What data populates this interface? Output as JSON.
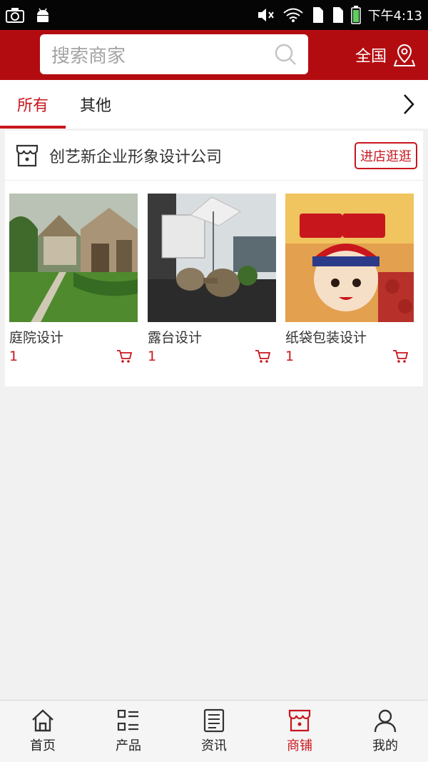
{
  "status_bar": {
    "time": "下午4:13"
  },
  "header": {
    "search_placeholder": "搜索商家",
    "region_label": "全国"
  },
  "tabs": [
    {
      "label": "所有"
    },
    {
      "label": "其他"
    }
  ],
  "shop": {
    "name": "创艺新企业形象设计公司",
    "enter_label": "进店逛逛",
    "products": [
      {
        "name": "庭院设计",
        "price": "1"
      },
      {
        "name": "露台设计",
        "price": "1"
      },
      {
        "name": "纸袋包装设计",
        "price": "1"
      }
    ]
  },
  "bottom_nav": [
    {
      "label": "首页"
    },
    {
      "label": "产品"
    },
    {
      "label": "资讯"
    },
    {
      "label": "商铺"
    },
    {
      "label": "我的"
    }
  ],
  "colors": {
    "brand_red": "#b30c10",
    "accent_red": "#c8161d"
  }
}
